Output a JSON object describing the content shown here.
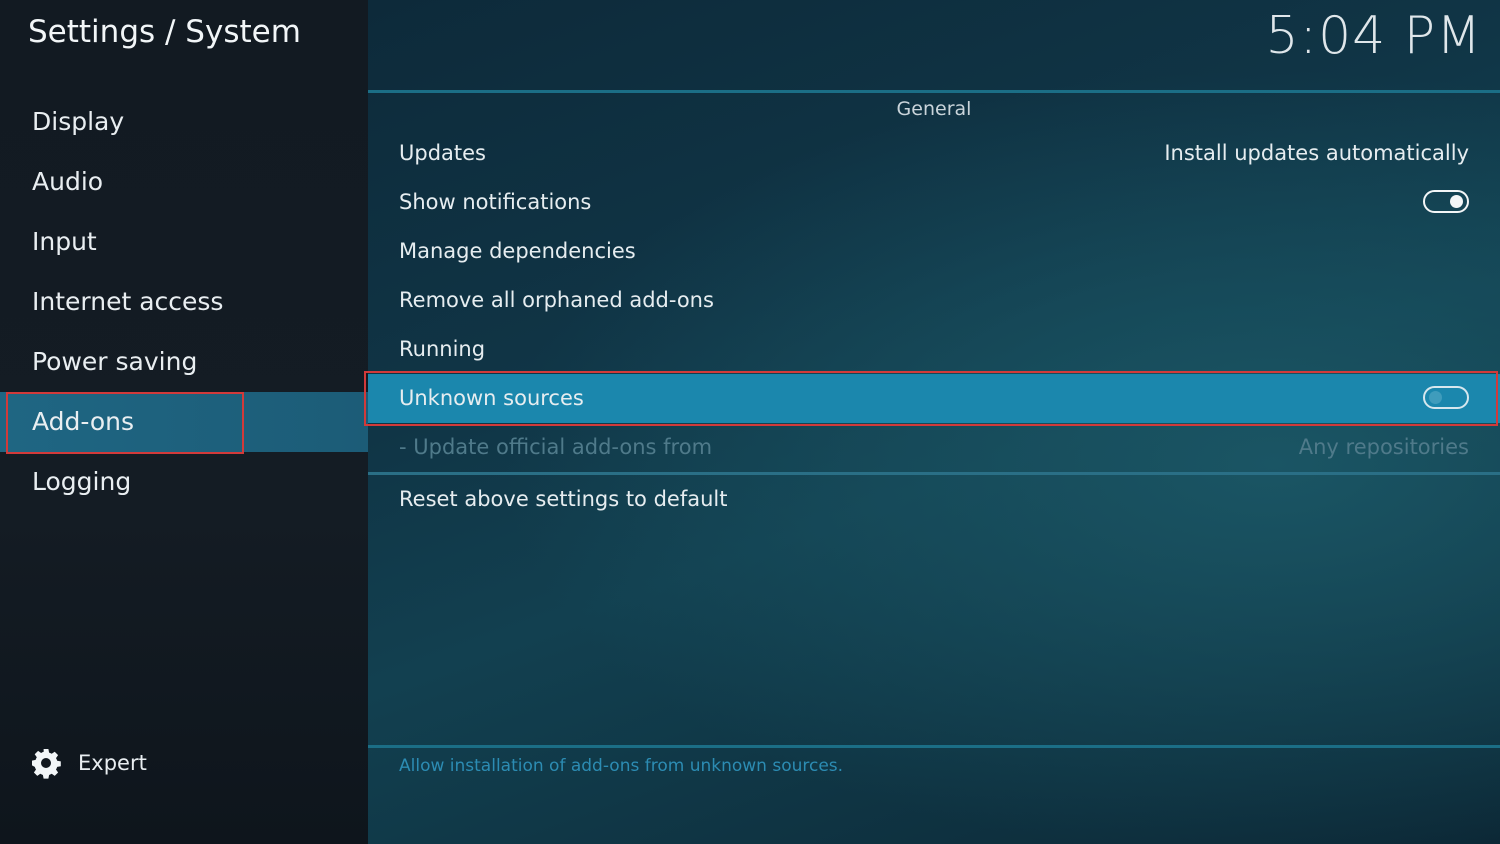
{
  "header": {
    "title": "Settings / System",
    "clock": "5:04 PM"
  },
  "sidebar": {
    "items": [
      {
        "label": "Display"
      },
      {
        "label": "Audio"
      },
      {
        "label": "Input"
      },
      {
        "label": "Internet access"
      },
      {
        "label": "Power saving"
      },
      {
        "label": "Add-ons",
        "active": true
      },
      {
        "label": "Logging"
      }
    ],
    "expert": {
      "label": "Expert",
      "icon": "gear-icon"
    }
  },
  "main": {
    "section_title": "General",
    "rows": {
      "updates": {
        "label": "Updates",
        "value": "Install updates automatically"
      },
      "show_notifications": {
        "label": "Show notifications",
        "toggle": "on"
      },
      "manage_dependencies": {
        "label": "Manage dependencies"
      },
      "remove_orphaned": {
        "label": "Remove all orphaned add-ons"
      },
      "running": {
        "label": "Running"
      },
      "unknown_sources": {
        "label": "Unknown sources",
        "toggle": "off",
        "focused": true
      },
      "update_official": {
        "label": "- Update official add-ons from",
        "value": "Any repositories",
        "disabled": true
      },
      "reset": {
        "label": "Reset above settings to default"
      }
    },
    "help_text": "Allow installation of add-ons from unknown sources."
  },
  "colors": {
    "accent": "#1b87ad",
    "focus_outline": "#d23a3a",
    "sidebar_active": "#1d5f7a"
  }
}
